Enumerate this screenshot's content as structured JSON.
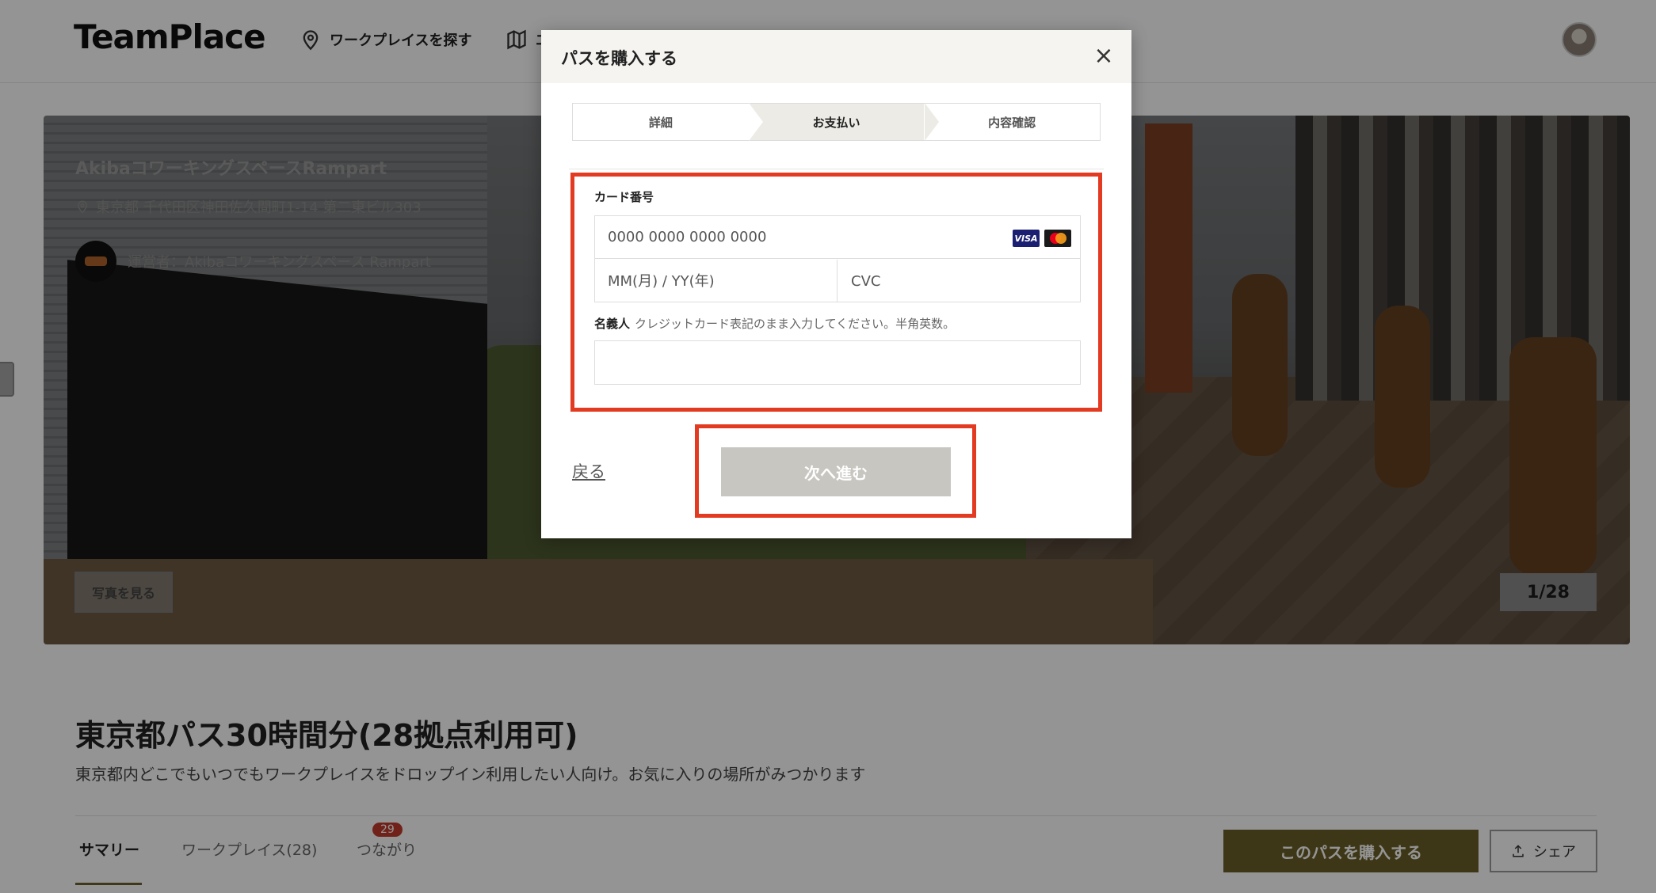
{
  "header": {
    "logo": "TeamPlace",
    "nav": [
      {
        "label": "ワークプレイスを探す",
        "icon": "map-pin-icon"
      },
      {
        "label": "エ",
        "icon": "map-icon"
      }
    ]
  },
  "hero": {
    "workspace_name": "AkibaコワーキングスペースRampart",
    "address": "東京都 千代田区神田佐久間町1-14 第二東ビル303",
    "operator": "運営者：Akibaコワーキングスペース Rampart",
    "photo_button": "写真を見る",
    "counter": "1/28"
  },
  "main": {
    "title": "東京都パス30時間分(28拠点利用可)",
    "description": "東京都内どこでもいつでもワークプレイスをドロップイン利用したい人向け。お気に入りの場所がみつかります",
    "tabs": [
      {
        "label": "サマリー",
        "active": true
      },
      {
        "label": "ワークプレイス(28)",
        "active": false
      },
      {
        "label": "つながり",
        "active": false,
        "badge": "29"
      }
    ],
    "buy_button": "このパスを購入する",
    "share_button": "シェア"
  },
  "modal": {
    "title": "パスを購入する",
    "close": "×",
    "steps": [
      {
        "label": "詳細",
        "active": false
      },
      {
        "label": "お支払い",
        "active": true
      },
      {
        "label": "内容確認",
        "active": false
      }
    ],
    "card_label": "カード番号",
    "card_number_placeholder": "0000 0000 0000 0000",
    "expiry_placeholder": "MM(月) / YY(年)",
    "cvc_placeholder": "CVC",
    "card_brands": [
      "VISA",
      "Mastercard"
    ],
    "holder_label": "名義人",
    "holder_hint": "クレジットカード表記のまま入力してください。半角英数。",
    "holder_value": "",
    "back_link": "戻る",
    "next_button": "次へ進む"
  },
  "colors": {
    "accent_brown": "#6b6029",
    "highlight_red": "#e33a22",
    "disabled_button": "#c8c6c0",
    "badge_red": "#c23b2d"
  }
}
